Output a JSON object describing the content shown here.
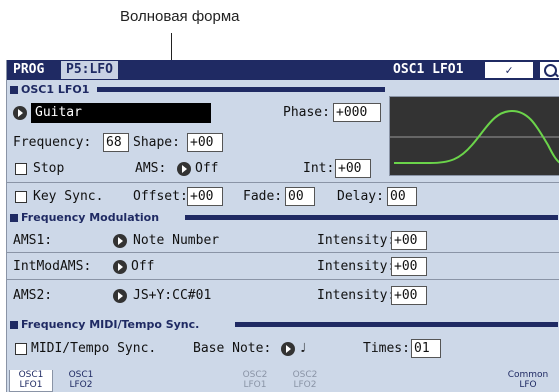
{
  "callout": "Волновая форма",
  "header": {
    "mode": "PROG",
    "page": "P5:LFO",
    "page_name": "OSC1 LFO1",
    "dropdown": "✓"
  },
  "section1": {
    "title": "OSC1 LFO1",
    "waveform": "Guitar",
    "phase_label": "Phase:",
    "phase": "+000",
    "frequency_label": "Frequency:",
    "frequency": "68",
    "shape_label": "Shape:",
    "shape": "+00",
    "stop_label": "Stop",
    "ams_label": "AMS:",
    "ams": "Off",
    "int_label": "Int:",
    "int": "+00",
    "key_sync_label": "Key Sync.",
    "offset_label": "Offset:",
    "offset": "+00",
    "fade_label": "Fade:",
    "fade": "00",
    "delay_label": "Delay:",
    "delay": "00"
  },
  "section2": {
    "title": "Frequency Modulation",
    "ams1_label": "AMS1:",
    "ams1": "Note Number",
    "intensity1_label": "Intensity:",
    "intensity1": "+00",
    "intmodams_label": "IntModAMS:",
    "intmodams": "Off",
    "intensity2_label": "Intensity:",
    "intensity2": "+00",
    "ams2_label": "AMS2:",
    "ams2": "JS+Y:CC#01",
    "intensity3_label": "Intensity:",
    "intensity3": "+00"
  },
  "section3": {
    "title": "Frequency MIDI/Tempo Sync.",
    "midi_sync_label": "MIDI/Tempo Sync.",
    "base_note_label": "Base Note:",
    "base_note": "♩",
    "times_label": "Times:",
    "times": "01"
  },
  "tabs": [
    {
      "l1": "OSC1",
      "l2": "LFO1"
    },
    {
      "l1": "OSC1",
      "l2": "LFO2"
    },
    {
      "l1": "OSC2",
      "l2": "LFO1"
    },
    {
      "l1": "OSC2",
      "l2": "LFO2"
    },
    {
      "l1": "Common",
      "l2": "LFO"
    }
  ]
}
